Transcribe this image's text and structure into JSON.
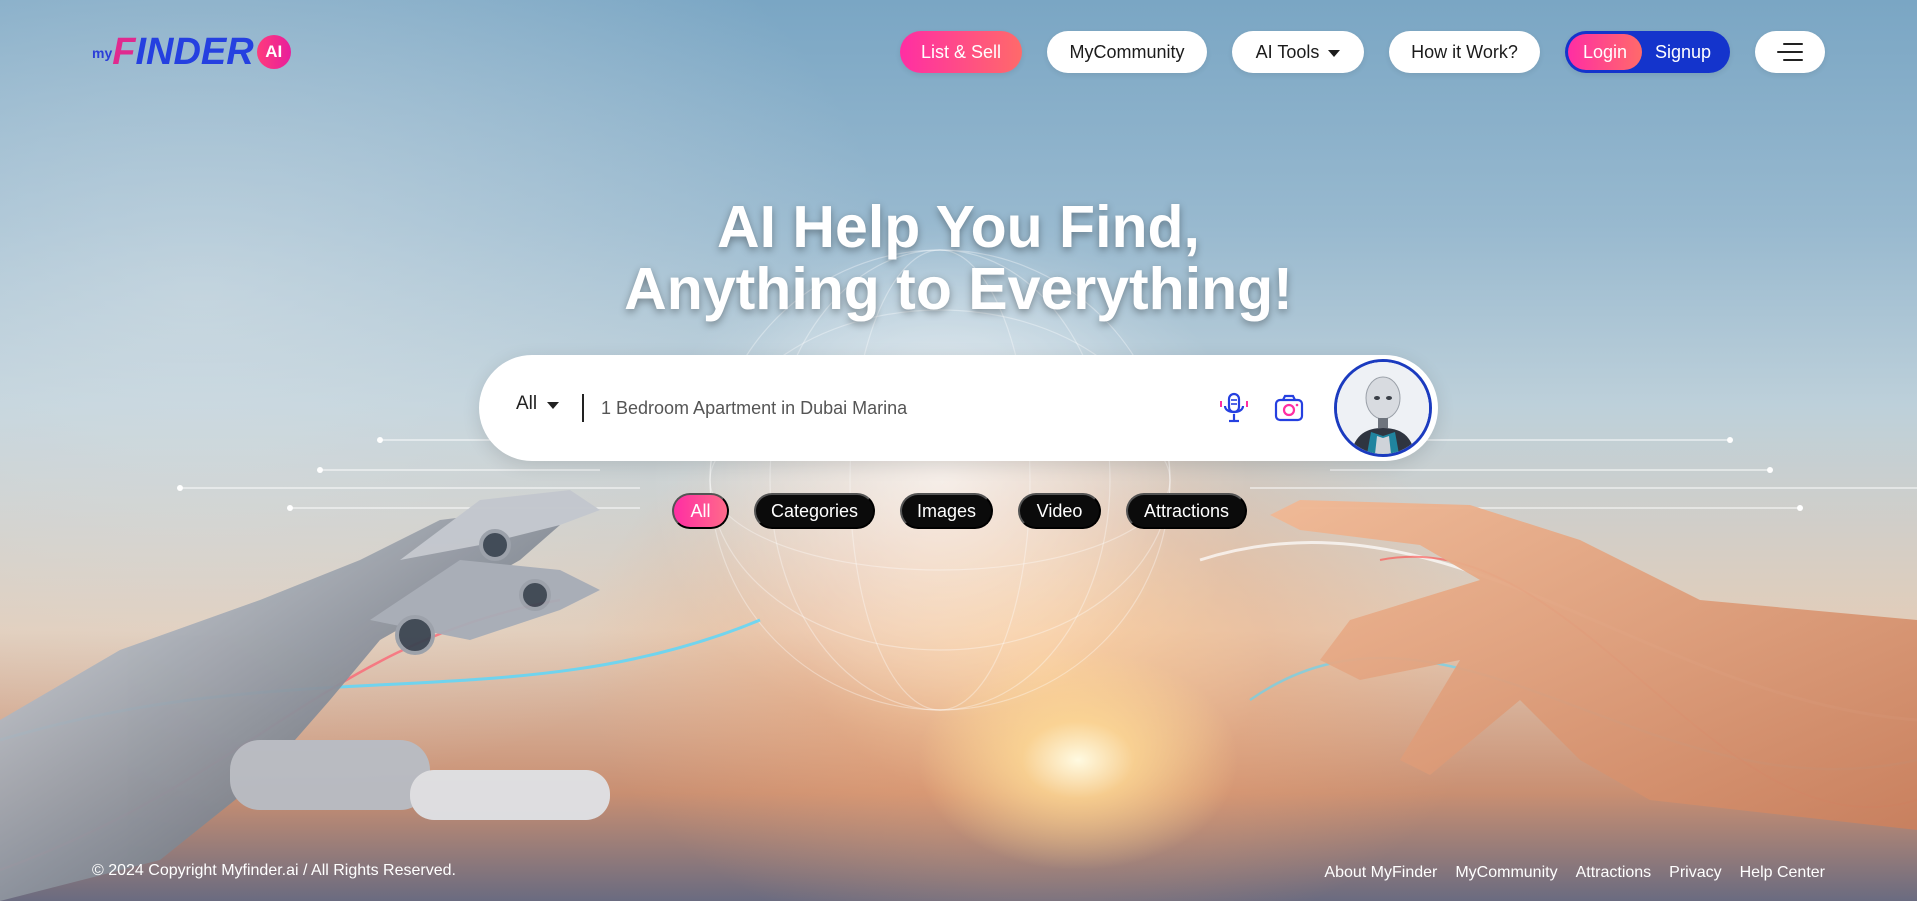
{
  "brand": {
    "logo_my": "my",
    "logo_f": "F",
    "logo_rest": "INDER",
    "logo_ai": "AI"
  },
  "nav": {
    "list_sell": "List & Sell",
    "community": "MyCommunity",
    "ai_tools": "AI Tools",
    "how_it_works": "How it Work?",
    "login": "Login",
    "signup": "Signup",
    "menu_icon": "hamburger-menu-icon"
  },
  "hero": {
    "title_line1": "AI Help You Find,",
    "title_line2": "Anything to Everything!"
  },
  "search": {
    "scope": "All",
    "placeholder": "1 Bedroom Apartment in Dubai Marina",
    "value": "",
    "mic_icon": "microphone-icon",
    "camera_icon": "camera-icon",
    "avatar_icon": "robot-avatar"
  },
  "filters": {
    "all": "All",
    "categories": "Categories",
    "images": "Images",
    "video": "Video",
    "attractions": "Attractions"
  },
  "footer": {
    "copyright": "© 2024 Copyright Myfinder.ai / All Rights Reserved.",
    "links": [
      "About MyFinder",
      "MyCommunity",
      "Attractions",
      "Privacy",
      "Help Center"
    ]
  },
  "colors": {
    "brand_blue": "#2540e0",
    "brand_pink": "#ff2ea3",
    "auth_blue": "#1434cc",
    "pill_dark": "#0b0b0b"
  }
}
